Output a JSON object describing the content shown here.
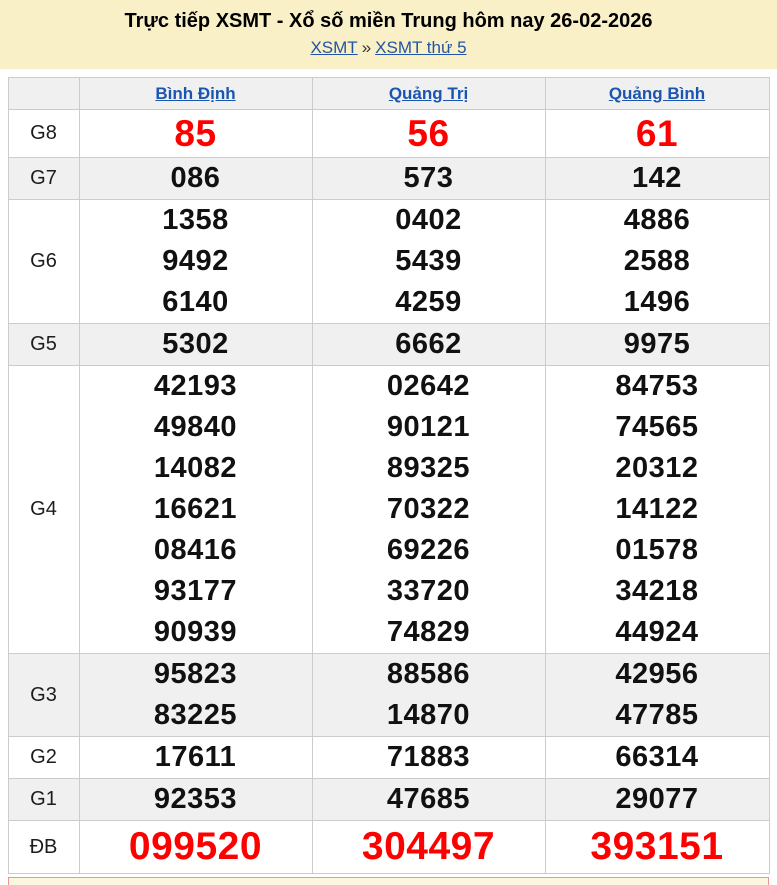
{
  "header": {
    "title": "Trực tiếp XSMT - Xổ số miền Trung hôm nay 26-02-2026",
    "breadcrumb": {
      "region_link": "XSMT",
      "separator": "»",
      "day_link": "XSMT thứ 5"
    }
  },
  "table": {
    "columns": [
      "Bình Định",
      "Quảng Trị",
      "Quảng Bình"
    ],
    "rows": [
      {
        "label": "G8",
        "special": "g8",
        "values": [
          [
            "85"
          ],
          [
            "56"
          ],
          [
            "61"
          ]
        ]
      },
      {
        "label": "G7",
        "special": "",
        "values": [
          [
            "086"
          ],
          [
            "573"
          ],
          [
            "142"
          ]
        ]
      },
      {
        "label": "G6",
        "special": "",
        "values": [
          [
            "1358",
            "9492",
            "6140"
          ],
          [
            "0402",
            "5439",
            "4259"
          ],
          [
            "4886",
            "2588",
            "1496"
          ]
        ]
      },
      {
        "label": "G5",
        "special": "",
        "values": [
          [
            "5302"
          ],
          [
            "6662"
          ],
          [
            "9975"
          ]
        ]
      },
      {
        "label": "G4",
        "special": "",
        "values": [
          [
            "42193",
            "49840",
            "14082",
            "16621",
            "08416",
            "93177",
            "90939"
          ],
          [
            "02642",
            "90121",
            "89325",
            "70322",
            "69226",
            "33720",
            "74829"
          ],
          [
            "84753",
            "74565",
            "20312",
            "14122",
            "01578",
            "34218",
            "44924"
          ]
        ]
      },
      {
        "label": "G3",
        "special": "",
        "values": [
          [
            "95823",
            "83225"
          ],
          [
            "88586",
            "14870"
          ],
          [
            "42956",
            "47785"
          ]
        ]
      },
      {
        "label": "G2",
        "special": "",
        "values": [
          [
            "17611"
          ],
          [
            "71883"
          ],
          [
            "66314"
          ]
        ]
      },
      {
        "label": "G1",
        "special": "",
        "values": [
          [
            "92353"
          ],
          [
            "47685"
          ],
          [
            "29077"
          ]
        ]
      },
      {
        "label": "ĐB",
        "special": "db",
        "values": [
          [
            "099520"
          ],
          [
            "304497"
          ],
          [
            "393151"
          ]
        ]
      }
    ]
  },
  "colors": {
    "banner_yellow": "#faf0c8",
    "link_blue": "#1a56b0",
    "accent_red": "#ff0000",
    "row_gray": "#f0f0f0",
    "border_gray": "#cccccc"
  }
}
